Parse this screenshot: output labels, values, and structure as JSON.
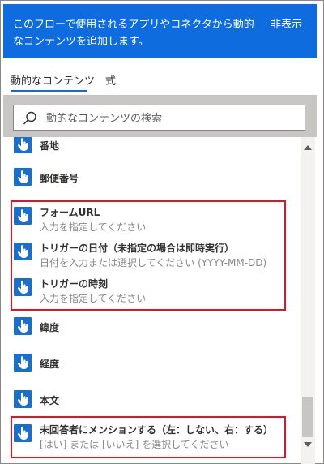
{
  "banner": {
    "text": "このフローで使用されるアプリやコネクタから動的なコンテンツを追加します。",
    "hide_label": "非表示"
  },
  "tabs": [
    {
      "label": "動的なコンテンツ",
      "selected": true
    },
    {
      "label": "式",
      "selected": false
    }
  ],
  "search": {
    "placeholder": "動的なコンテンツの検索",
    "value": ""
  },
  "items": [
    {
      "title": "番地",
      "subtitle": ""
    },
    {
      "title": "郵便番号",
      "subtitle": ""
    },
    {
      "title": "フォームURL",
      "subtitle": "入力を指定してください"
    },
    {
      "title": "トリガーの日付（未指定の場合は即時実行）",
      "subtitle": "日付を入力または選択してください (YYYY-MM-DD)"
    },
    {
      "title": "トリガーの時刻",
      "subtitle": "入力を指定してください"
    },
    {
      "title": "緯度",
      "subtitle": ""
    },
    {
      "title": "経度",
      "subtitle": ""
    },
    {
      "title": "本文",
      "subtitle": ""
    },
    {
      "title": "未回答者にメンションする（左：しない、右：する）",
      "subtitle": "[はい] または [いいえ] を選択してください"
    }
  ],
  "colors": {
    "accent": "#0f6cde",
    "icon_bg": "#1a6fc9",
    "highlight": "#e81123"
  },
  "icon": "touch-hand-icon"
}
